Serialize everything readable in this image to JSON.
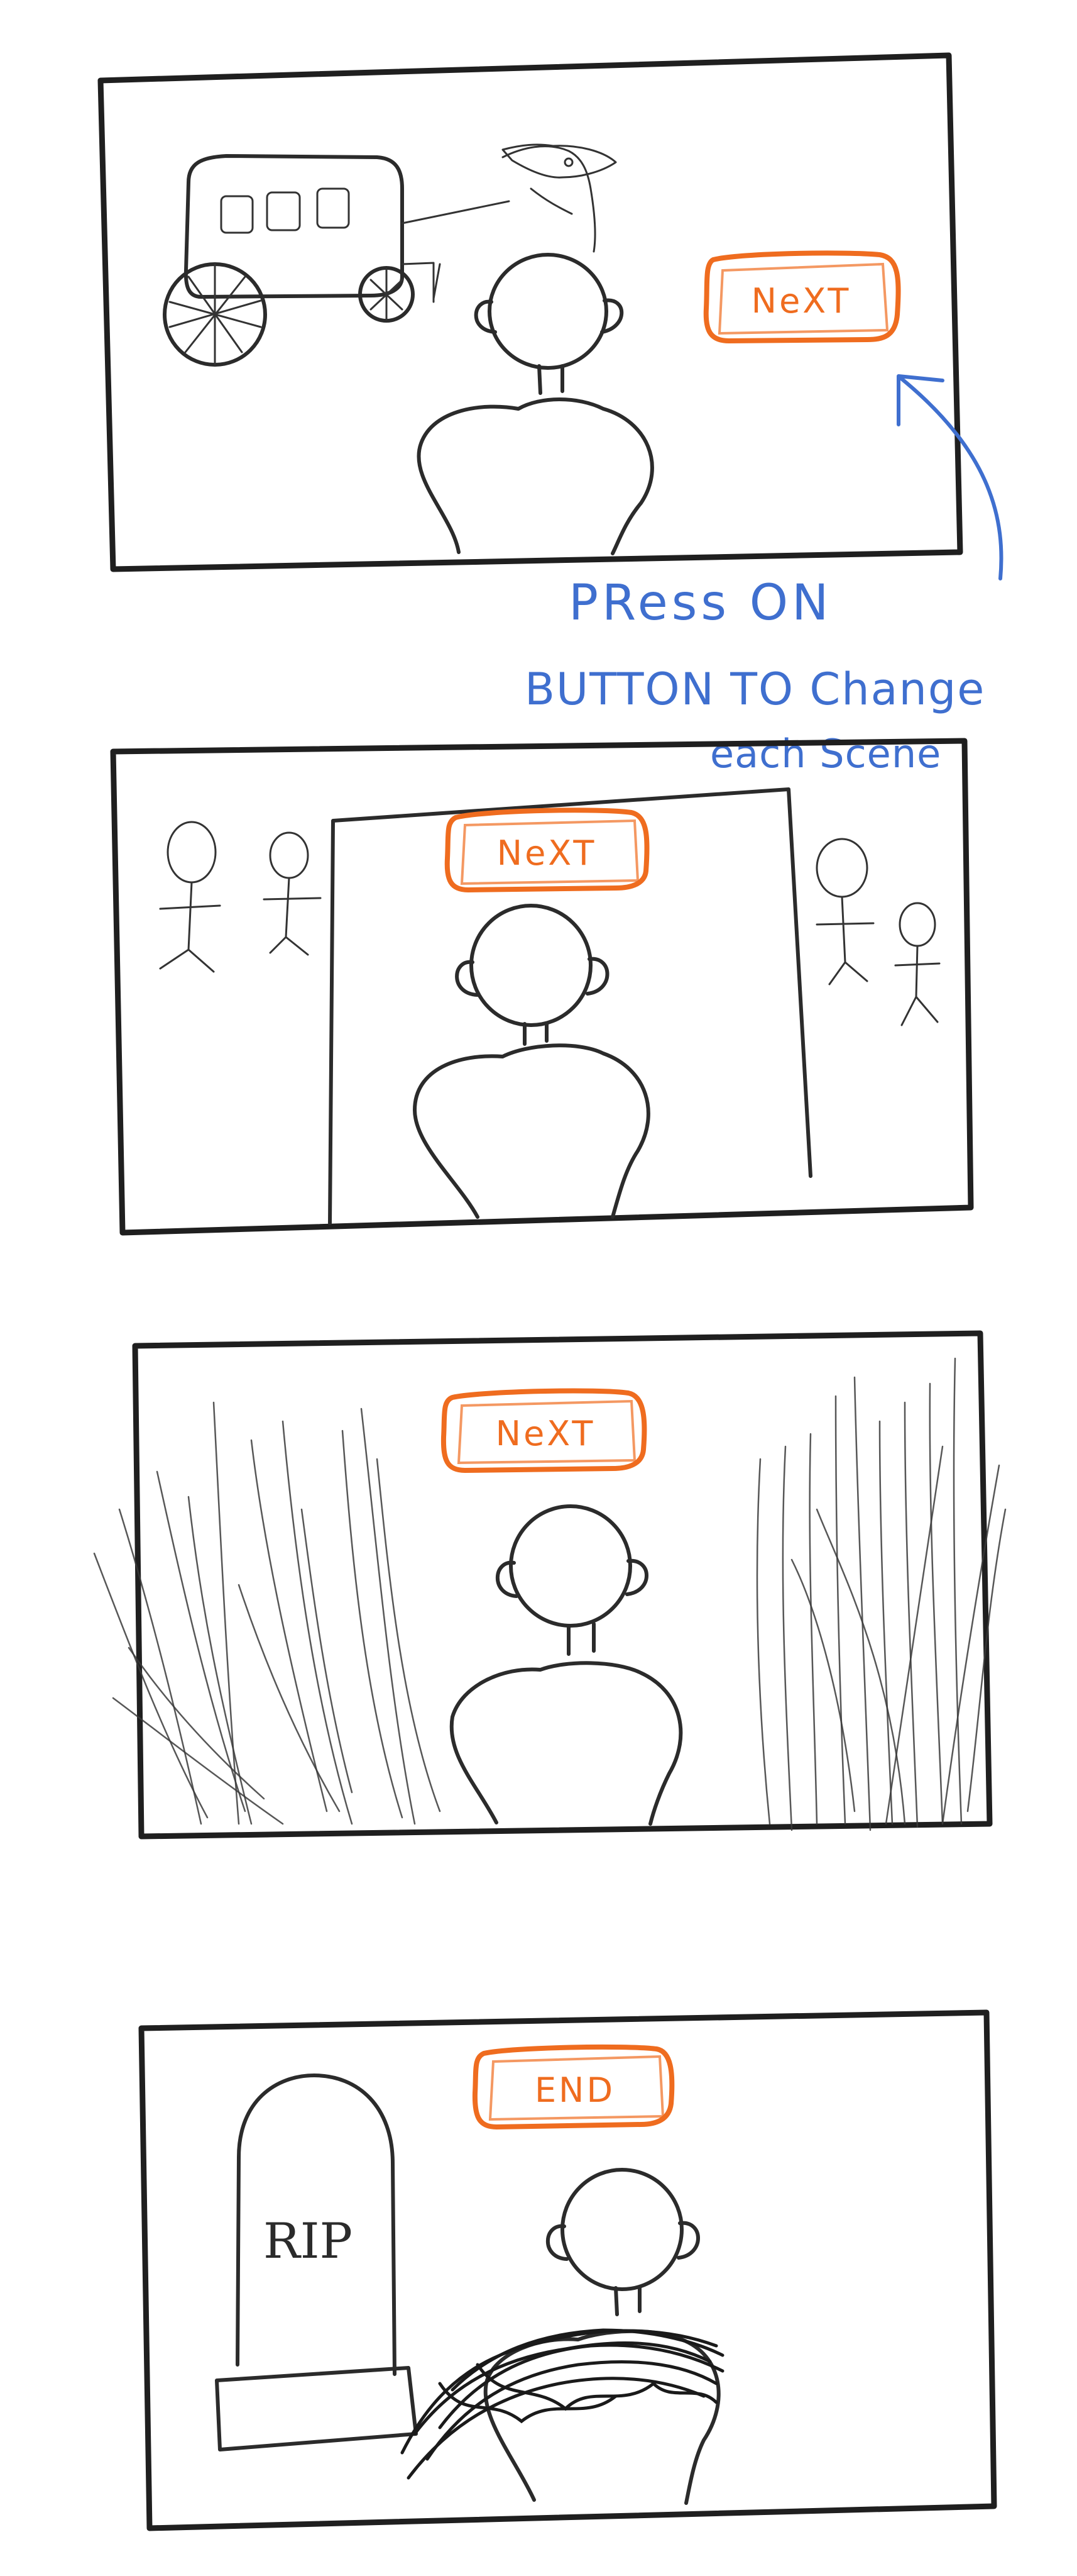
{
  "panels": [
    {
      "button_label": "NeXT"
    },
    {
      "button_label": "NeXT"
    },
    {
      "button_label": "NeXT"
    },
    {
      "button_label": "END"
    }
  ],
  "annotation": {
    "line1": "PRess ON",
    "line2": "BUTTON TO Change",
    "line3": "each Scene",
    "color": "#3f6fcf"
  },
  "tombstone": {
    "label": "RIP"
  },
  "colors": {
    "button": "#ef6c1f",
    "ink": "#2b2b2b"
  }
}
